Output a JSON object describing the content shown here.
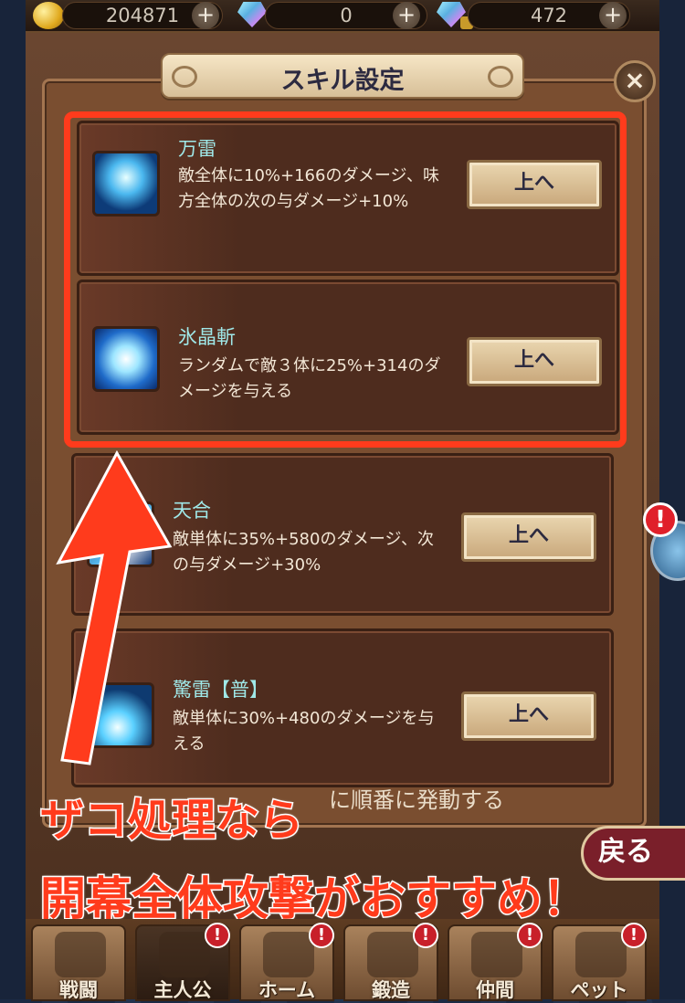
{
  "currency": {
    "gold": "204871",
    "gems": "0",
    "locked_gems": "472",
    "plus_label": "+"
  },
  "window": {
    "title": "スキル設定",
    "close_label": "×"
  },
  "skills": [
    {
      "name": "万雷",
      "desc": "敵全体に10%+166のダメージ、味方全体の次の与ダメージ+10%",
      "button": "上へ",
      "icon": "lightning-storm-icon"
    },
    {
      "name": "氷晶斬",
      "desc": "ランダムで敵３体に25%+314のダメージを与える",
      "button": "上へ",
      "icon": "ice-crystal-icon"
    },
    {
      "name": "天合",
      "desc": "敵単体に35%+580のダメージ、次の与ダメージ+30%",
      "button": "上へ",
      "icon": "sky-union-icon"
    },
    {
      "name": "驚雷【普】",
      "desc": "敵単体に30%+480のダメージを与える",
      "button": "上へ",
      "icon": "thunder-strike-icon"
    }
  ],
  "footer_note": "に順番に発動する",
  "annotation": {
    "line1": "ザコ処理なら",
    "line2": "開幕全体攻撃がおすすめ！"
  },
  "back_label": "戻る",
  "alert_label": "!",
  "nav": [
    {
      "label": "戦闘",
      "icon": "shield-sword-icon",
      "alert": false
    },
    {
      "label": "主人公",
      "icon": "hero-helmet-icon",
      "alert": true
    },
    {
      "label": "ホーム",
      "icon": "castle-icon",
      "alert": true
    },
    {
      "label": "鍛造",
      "icon": "hammer-icon",
      "alert": true
    },
    {
      "label": "仲間",
      "icon": "handshake-icon",
      "alert": true
    },
    {
      "label": "ペット",
      "icon": "cat-face-icon",
      "alert": true
    }
  ],
  "colors": {
    "highlight": "#ff3b1c",
    "skill_name": "#9fe8e8",
    "panel": "#7a4e30"
  }
}
